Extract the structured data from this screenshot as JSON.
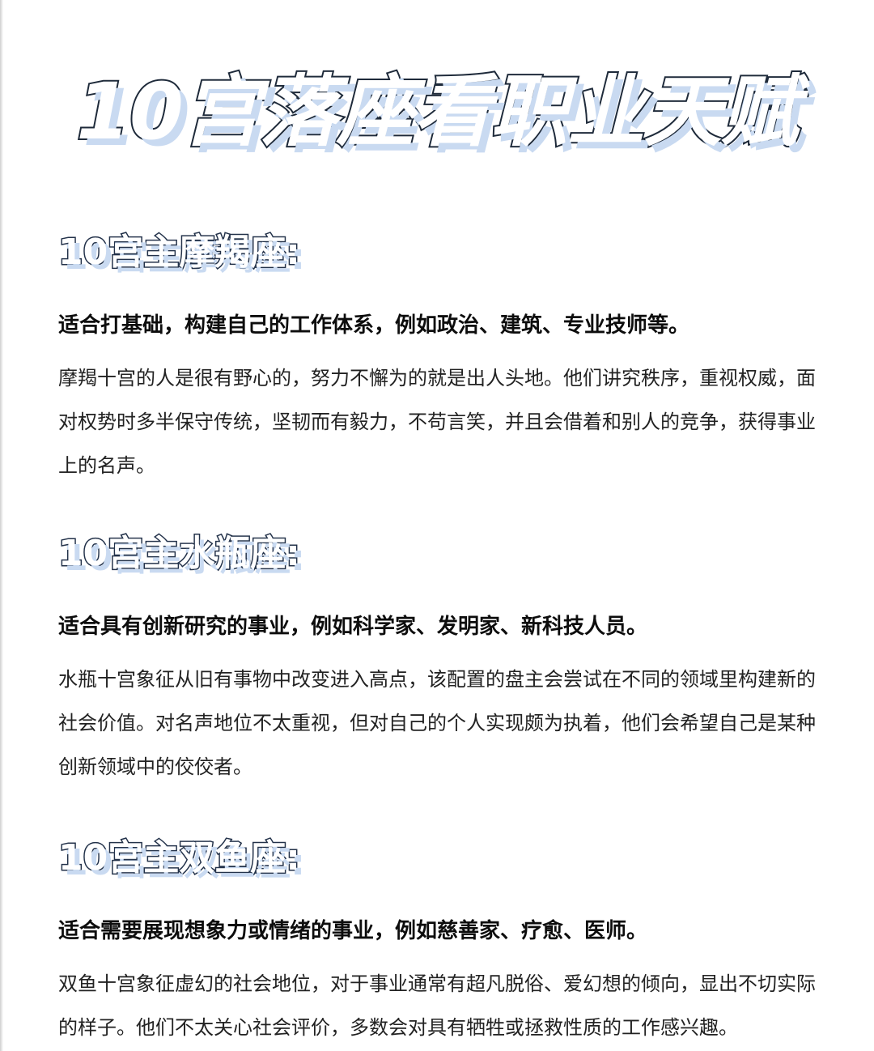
{
  "title": "10宫落座看职业天赋",
  "sections": [
    {
      "heading": "10宫主摩羯座:",
      "summary": "适合打基础，构建自己的工作体系，例如政治、建筑、专业技师等。",
      "body": "摩羯十宫的人是很有野心的，努力不懈为的就是出人头地。他们讲究秩序，重视权威，面对权势时多半保守传统，坚韧而有毅力，不苟言笑，并且会借着和别人的竞争，获得事业上的名声。"
    },
    {
      "heading": "10宫主水瓶座:",
      "summary": "适合具有创新研究的事业，例如科学家、发明家、新科技人员。",
      "body": "水瓶十宫象征从旧有事物中改变进入高点，该配置的盘主会尝试在不同的领域里构建新的社会价值。对名声地位不太重视，但对自己的个人实现颇为执着，他们会希望自己是某种创新领域中的佼佼者。"
    },
    {
      "heading": "10宫主双鱼座:",
      "summary": "适合需要展现想象力或情绪的事业，例如慈善家、疗愈、医师。",
      "body": "双鱼十宫象征虚幻的社会地位，对于事业通常有超凡脱俗、爱幻想的倾向，显出不切实际的样子。他们不太关心社会评价，多数会对具有牺牲或拯救性质的工作感兴趣。"
    }
  ]
}
